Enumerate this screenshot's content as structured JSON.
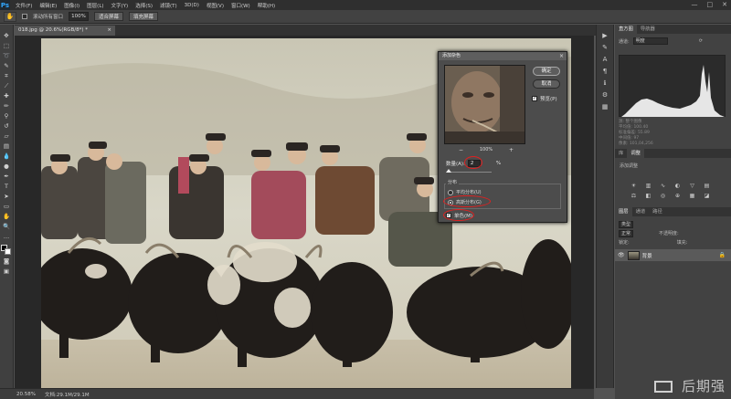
{
  "app": {
    "logo": "Ps"
  },
  "menu": [
    "文件(F)",
    "编辑(E)",
    "图像(I)",
    "图层(L)",
    "文字(Y)",
    "选择(S)",
    "滤镜(T)",
    "3D(D)",
    "视图(V)",
    "窗口(W)",
    "帮助(H)"
  ],
  "window_controls": {
    "minimize": "—",
    "maximize": "□",
    "close": "✕"
  },
  "options_bar": {
    "tool_icon": "hand-icon",
    "scroll_all_label": "滚动所有窗口",
    "zoom_value": "100%",
    "fit_screen_label": "适合屏幕",
    "fill_screen_label": "填充屏幕"
  },
  "document": {
    "tab_title": "018.jpg @ 20.6%(RGB/8*) *",
    "tab_close": "×"
  },
  "status_bar": {
    "zoom": "20.58%",
    "doc_size": "文档:29.1M/29.1M"
  },
  "panels": {
    "top_tabs": [
      "直方图",
      "导航器"
    ],
    "channel_label": "通道:",
    "channel_value": "明度",
    "source_label": "源:",
    "source_value": "整个图像",
    "stats": [
      "平均值: 100.40",
      "标准偏差: 55.89",
      "中间值: 97",
      "像素: 101,04,256"
    ],
    "adjust_tabs": [
      "库",
      "调整"
    ],
    "adjust_title": "添加调整",
    "layers_tabs": [
      "图层",
      "通道",
      "路径"
    ],
    "kind_label": "类型",
    "blend_mode": "正常",
    "opacity_label": "不透明度:",
    "lock_label": "锁定:",
    "fill_label": "填充:",
    "layer_name": "背景",
    "colors": {
      "histogram": "#e6e6e6",
      "selected_layer": "#5a5a5a"
    }
  },
  "dialog": {
    "title": "添加杂色",
    "ok_label": "确定",
    "cancel_label": "取消",
    "preview_label": "预览(P)",
    "zoom_out": "−",
    "zoom_in": "+",
    "zoom_value": "100%",
    "amount_label": "数量(A):",
    "amount_value": "2",
    "amount_unit": "%",
    "amount_fraction": 0.02,
    "distribution_label": "分布",
    "uniform_label": "平均分布(U)",
    "gaussian_label": "高斯分布(G)",
    "selected_distribution": "gaussian",
    "mono_label": "单色(M)",
    "mono_checked": true,
    "annotation_color": "#e02020"
  },
  "watermark": {
    "text": "后期强"
  }
}
